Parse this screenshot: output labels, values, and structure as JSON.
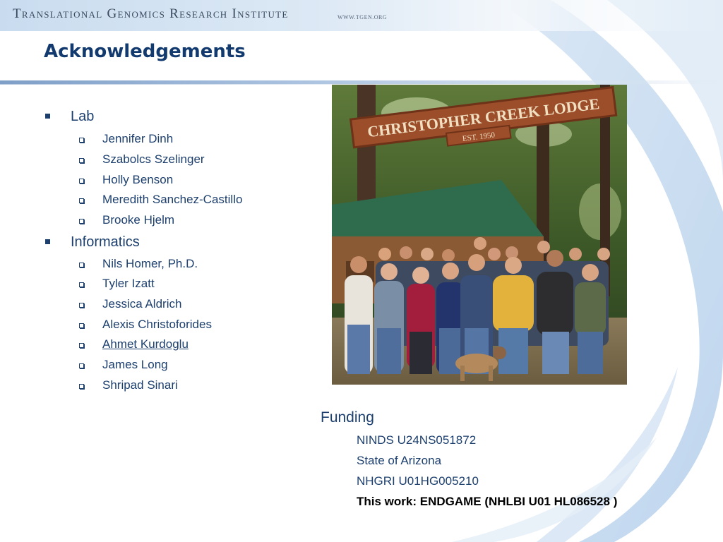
{
  "header": {
    "org_name": "Translational Genomics Research Institute",
    "org_url": "WWW.TGEN.ORG"
  },
  "title": "Acknowledgements",
  "sections": [
    {
      "label": "Lab",
      "items": [
        "Jennifer Dinh",
        "Szabolcs Szelinger",
        "Holly Benson",
        "Meredith Sanchez-Castillo",
        "Brooke Hjelm"
      ]
    },
    {
      "label": "Informatics",
      "items": [
        "Nils Homer, Ph.D.",
        "Tyler Izatt",
        "Jessica Aldrich",
        "Alexis Christoforides",
        "Ahmet Kurdoglu",
        "James Long",
        "Shripad Sinari"
      ]
    }
  ],
  "photo": {
    "sign_text": "CHRISTOPHER CREEK LODGE",
    "sign_est": "EST. 1950"
  },
  "funding": {
    "title": "Funding",
    "items": [
      "NINDS U24NS051872",
      "State of Arizona",
      "NHGRI U01HG005210"
    ],
    "this_work": "This work: ENDGAME (NHLBI U01 HL086528 )"
  },
  "colors": {
    "title": "#123a6e",
    "text": "#1c3f6e",
    "accent_light": "#c9dcef"
  }
}
